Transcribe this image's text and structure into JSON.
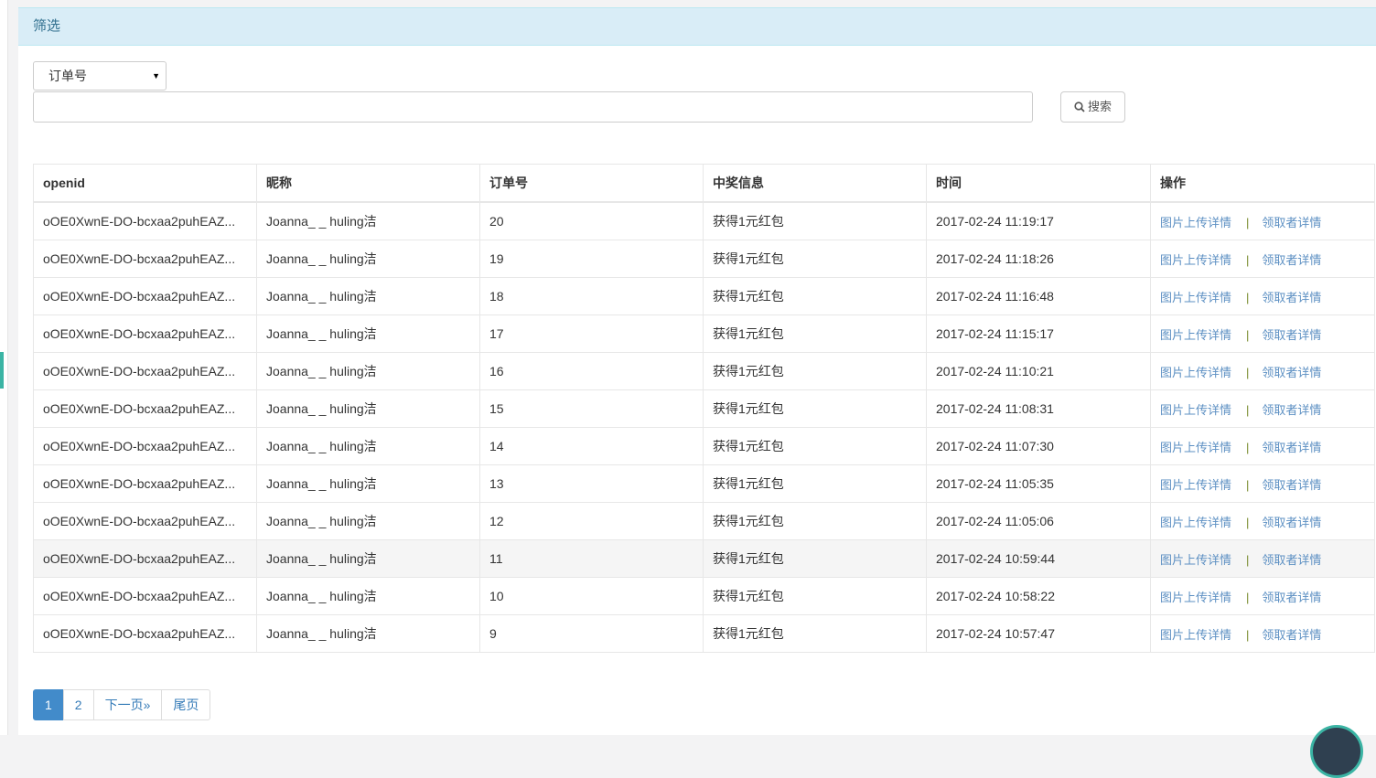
{
  "panel": {
    "title": "筛选"
  },
  "filter": {
    "select_value": "订单号",
    "input_value": "",
    "search_label": "搜索"
  },
  "table": {
    "headers": [
      "openid",
      "昵称",
      "订单号",
      "中奖信息",
      "时间",
      "操作"
    ],
    "rows": [
      {
        "openid": "oOE0XwnE-DO-bcxaa2puhEAZ...",
        "nickname": "Joanna_ _ huling洁",
        "order": "20",
        "prize": "获得1元红包",
        "time": "2017-02-24 11:19:17",
        "action1": "图片上传详情",
        "action2": "领取者详情"
      },
      {
        "openid": "oOE0XwnE-DO-bcxaa2puhEAZ...",
        "nickname": "Joanna_ _ huling洁",
        "order": "19",
        "prize": "获得1元红包",
        "time": "2017-02-24 11:18:26",
        "action1": "图片上传详情",
        "action2": "领取者详情"
      },
      {
        "openid": "oOE0XwnE-DO-bcxaa2puhEAZ...",
        "nickname": "Joanna_ _ huling洁",
        "order": "18",
        "prize": "获得1元红包",
        "time": "2017-02-24 11:16:48",
        "action1": "图片上传详情",
        "action2": "领取者详情"
      },
      {
        "openid": "oOE0XwnE-DO-bcxaa2puhEAZ...",
        "nickname": "Joanna_ _ huling洁",
        "order": "17",
        "prize": "获得1元红包",
        "time": "2017-02-24 11:15:17",
        "action1": "图片上传详情",
        "action2": "领取者详情"
      },
      {
        "openid": "oOE0XwnE-DO-bcxaa2puhEAZ...",
        "nickname": "Joanna_ _ huling洁",
        "order": "16",
        "prize": "获得1元红包",
        "time": "2017-02-24 11:10:21",
        "action1": "图片上传详情",
        "action2": "领取者详情"
      },
      {
        "openid": "oOE0XwnE-DO-bcxaa2puhEAZ...",
        "nickname": "Joanna_ _ huling洁",
        "order": "15",
        "prize": "获得1元红包",
        "time": "2017-02-24 11:08:31",
        "action1": "图片上传详情",
        "action2": "领取者详情"
      },
      {
        "openid": "oOE0XwnE-DO-bcxaa2puhEAZ...",
        "nickname": "Joanna_ _ huling洁",
        "order": "14",
        "prize": "获得1元红包",
        "time": "2017-02-24 11:07:30",
        "action1": "图片上传详情",
        "action2": "领取者详情"
      },
      {
        "openid": "oOE0XwnE-DO-bcxaa2puhEAZ...",
        "nickname": "Joanna_ _ huling洁",
        "order": "13",
        "prize": "获得1元红包",
        "time": "2017-02-24 11:05:35",
        "action1": "图片上传详情",
        "action2": "领取者详情"
      },
      {
        "openid": "oOE0XwnE-DO-bcxaa2puhEAZ...",
        "nickname": "Joanna_ _ huling洁",
        "order": "12",
        "prize": "获得1元红包",
        "time": "2017-02-24 11:05:06",
        "action1": "图片上传详情",
        "action2": "领取者详情"
      },
      {
        "openid": "oOE0XwnE-DO-bcxaa2puhEAZ...",
        "nickname": "Joanna_ _ huling洁",
        "order": "11",
        "prize": "获得1元红包",
        "time": "2017-02-24 10:59:44",
        "action1": "图片上传详情",
        "action2": "领取者详情"
      },
      {
        "openid": "oOE0XwnE-DO-bcxaa2puhEAZ...",
        "nickname": "Joanna_ _ huling洁",
        "order": "10",
        "prize": "获得1元红包",
        "time": "2017-02-24 10:58:22",
        "action1": "图片上传详情",
        "action2": "领取者详情"
      },
      {
        "openid": "oOE0XwnE-DO-bcxaa2puhEAZ...",
        "nickname": "Joanna_ _ huling洁",
        "order": "9",
        "prize": "获得1元红包",
        "time": "2017-02-24 10:57:47",
        "action1": "图片上传详情",
        "action2": "领取者详情"
      }
    ],
    "separator": "|",
    "highlighted_row": 9
  },
  "pagination": {
    "pages": [
      "1",
      "2"
    ],
    "next": "下一页»",
    "last": "尾页",
    "current": "1"
  },
  "colors": {
    "header_bg": "#d9edf7",
    "header_text": "#31708f",
    "link": "#5d90c3",
    "active_page": "#428bca",
    "accent": "#3bb4a4"
  }
}
